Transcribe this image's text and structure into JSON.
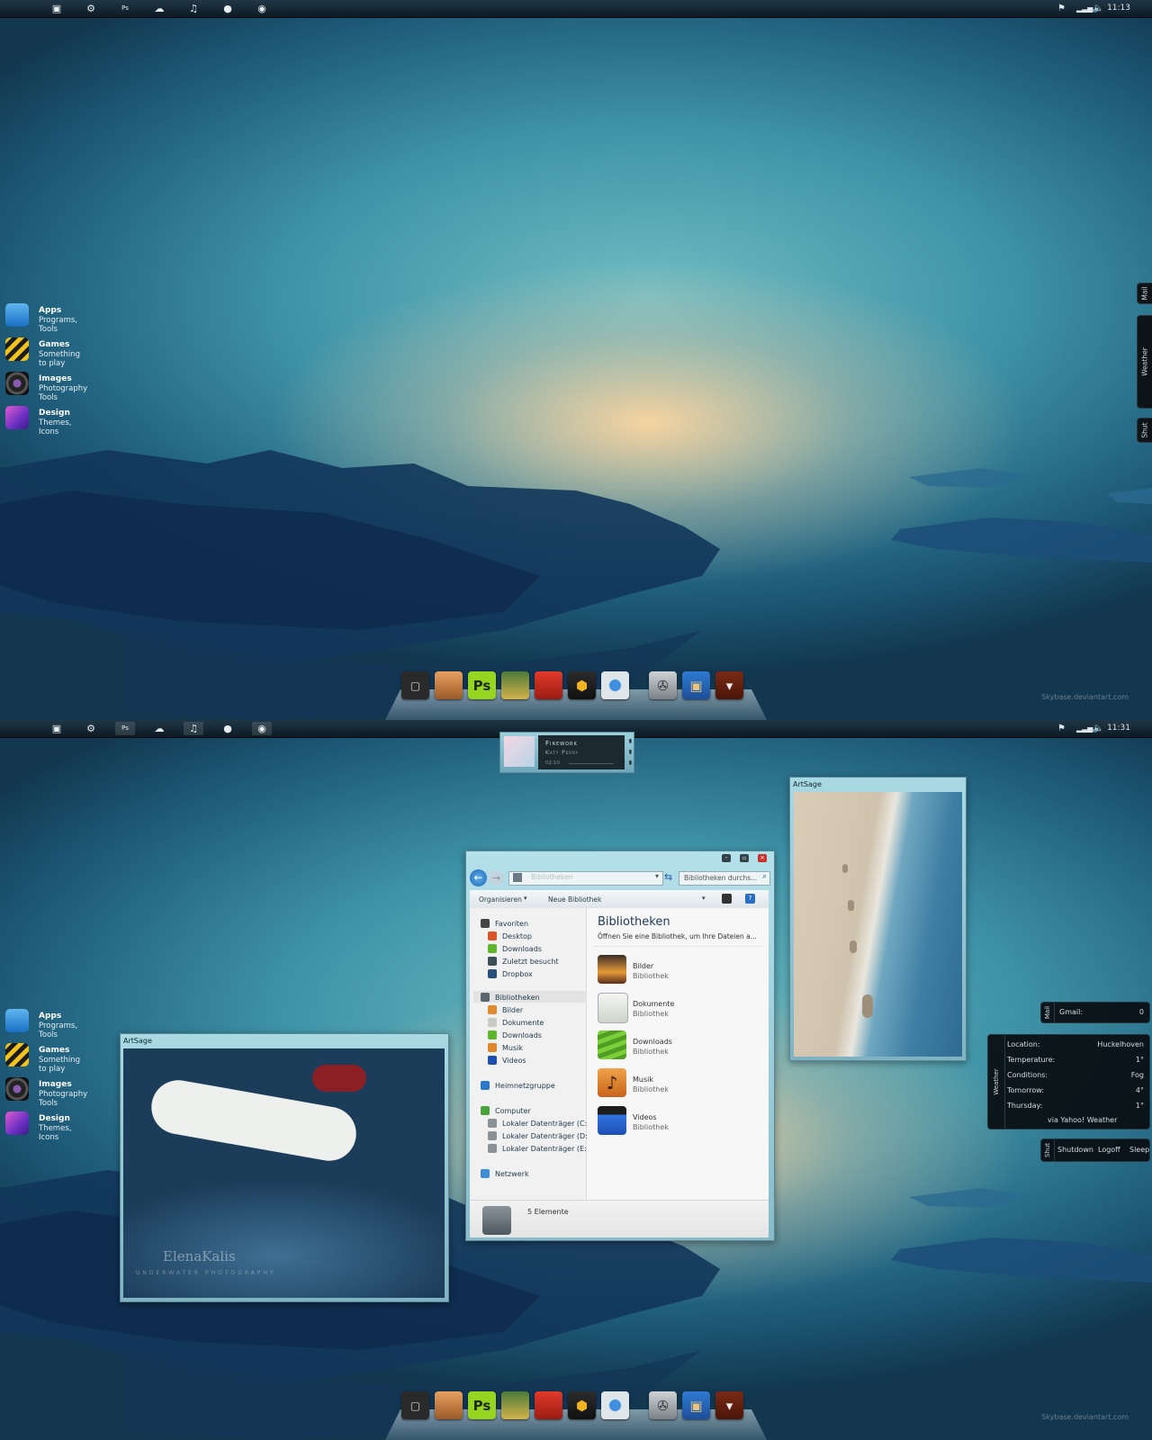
{
  "screen1": {
    "clock": "11:13",
    "credit": "Skybase.deviantart.com"
  },
  "screen2": {
    "clock": "11:31",
    "credit": "Skybase.deviantart.com",
    "music": {
      "title": "Firework",
      "artist": "Katy Perry",
      "time": "02:10"
    },
    "photo_left": {
      "title": "ArtSage",
      "watermark": "ElenaKalis",
      "watermark_sub": "UNDERWATER PHOTOGRAPHY"
    },
    "photo_right": {
      "title": "ArtSage"
    },
    "explorer": {
      "address": "Bibliotheken",
      "search_placeholder": "Bibliotheken durchs...",
      "toolbar": {
        "organize": "Organisieren",
        "new_library": "Neue Bibliothek"
      },
      "heading": "Bibliotheken",
      "subheading": "Öffnen Sie eine Bibliothek, um Ihre Dateien a...",
      "nav": {
        "favorites": "Favoriten",
        "fav_items": [
          "Desktop",
          "Downloads",
          "Zuletzt besucht",
          "Dropbox"
        ],
        "libraries": "Bibliotheken",
        "lib_items": [
          "Bilder",
          "Dokumente",
          "Downloads",
          "Musik",
          "Videos"
        ],
        "homegroup": "Heimnetzgruppe",
        "computer": "Computer",
        "drives": [
          "Lokaler Datenträger (C:)",
          "Lokaler Datenträger (D:)",
          "Lokaler Datenträger (E:)"
        ],
        "network": "Netzwerk"
      },
      "libraries": [
        {
          "name": "Bilder",
          "type": "Bibliothek"
        },
        {
          "name": "Dokumente",
          "type": "Bibliothek"
        },
        {
          "name": "Downloads",
          "type": "Bibliothek"
        },
        {
          "name": "Musik",
          "type": "Bibliothek"
        },
        {
          "name": "Videos",
          "type": "Bibliothek"
        }
      ],
      "status": "5 Elemente"
    },
    "mail": {
      "label": "Gmail:",
      "count": "0",
      "tab": "Mail"
    },
    "weather": {
      "tab": "Weather",
      "rows": [
        {
          "k": "Location:",
          "v": "Huckelhoven"
        },
        {
          "k": "Temperature:",
          "v": "1°"
        },
        {
          "k": "Conditions:",
          "v": "Fog"
        },
        {
          "k": "Tomorrow:",
          "v": "4°"
        },
        {
          "k": "Thursday:",
          "v": "1°"
        }
      ],
      "source": "via Yahoo! Weather"
    },
    "shut": {
      "tab": "Shut",
      "shutdown": "Shutdown",
      "logoff": "Logoff",
      "sleep": "Sleep"
    }
  },
  "sidetabs": {
    "mail": "Mail",
    "weather": "Weather",
    "shut": "Shut"
  },
  "launcher": [
    {
      "title": "Apps",
      "sub": "Programs, Tools",
      "icon": "app-store-icon"
    },
    {
      "title": "Games",
      "sub": "Something to play",
      "icon": "hazard-stripes-icon"
    },
    {
      "title": "Images",
      "sub": "Photography Tools",
      "icon": "camera-lens-icon"
    },
    {
      "title": "Design",
      "sub": "Themes, Icons",
      "icon": "design-icon"
    }
  ],
  "dock": [
    {
      "name": "terminal",
      "icon": "terminal-icon"
    },
    {
      "name": "speaker",
      "icon": "speaker-icon"
    },
    {
      "name": "photoshop",
      "label": "Ps",
      "icon": "photoshop-icon"
    },
    {
      "name": "photo",
      "icon": "photo-icon"
    },
    {
      "name": "angry-birds",
      "icon": "angry-birds-icon"
    },
    {
      "name": "hexagons",
      "icon": "hexagons-icon"
    },
    {
      "name": "chrome",
      "icon": "chrome-icon"
    },
    {
      "name": "video",
      "icon": "film-reel-icon"
    },
    {
      "name": "box",
      "icon": "package-icon"
    },
    {
      "name": "domo",
      "icon": "domo-icon"
    }
  ],
  "colors": {
    "accent": "#2a8fb0",
    "panel": "#0d1418",
    "frame": "#9fd0dc"
  }
}
